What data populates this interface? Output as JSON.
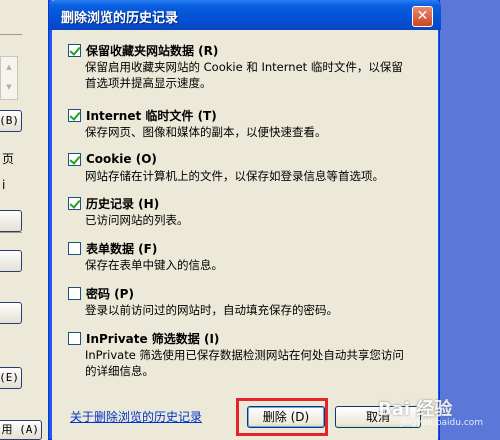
{
  "background_window": {
    "buttons": [
      "(B)",
      "(E)"
    ],
    "side_text": [
      "页",
      "i"
    ],
    "bottom_button": "用 (A)"
  },
  "dialog": {
    "title": "删除浏览的历史记录",
    "close_symbol": "✕",
    "items": [
      {
        "label": "保留收藏夹网站数据 (R)",
        "checked": true,
        "desc_lines": [
          "保留启用收藏夹网站的 Cookie 和 Internet 临时文件，以保留",
          "首选项并提高显示速度。"
        ]
      },
      {
        "label": "Internet 临时文件 (T)",
        "checked": true,
        "desc_lines": [
          "保存网页、图像和媒体的副本，以便快速查看。"
        ]
      },
      {
        "label": "Cookie (O)",
        "checked": true,
        "desc_lines": [
          "网站存储在计算机上的文件，以保存如登录信息等首选项。"
        ]
      },
      {
        "label": "历史记录 (H)",
        "checked": true,
        "desc_lines": [
          "已访问网站的列表。"
        ]
      },
      {
        "label": "表单数据 (F)",
        "checked": false,
        "desc_lines": [
          "保存在表单中键入的信息。"
        ]
      },
      {
        "label": "密码 (P)",
        "checked": false,
        "desc_lines": [
          "登录以前访问过的网站时，自动填充保存的密码。"
        ]
      },
      {
        "label": "InPrivate 筛选数据 (I)",
        "checked": false,
        "desc_lines": [
          "InPrivate 筛选使用已保存数据检测网站在何处自动共享您访问",
          "的详细信息。"
        ]
      }
    ],
    "about_link": "关于删除浏览的历史记录",
    "delete_label": "删除 (D)",
    "cancel_label": "取消"
  },
  "watermark": {
    "text": "Bai 经验",
    "sub": "jingyan.baidu.com"
  },
  "colors": {
    "titlebar": "#0351d6",
    "highlight": "#e3242b",
    "link": "#0033cc"
  }
}
